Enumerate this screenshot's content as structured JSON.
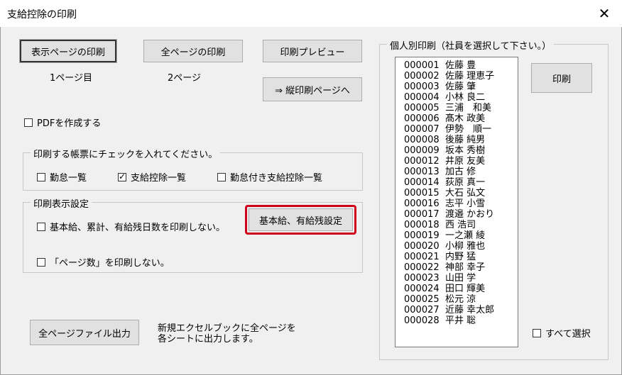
{
  "window": {
    "title": "支給控除の印刷"
  },
  "buttons": {
    "print_display_page": "表示ページの印刷",
    "print_all_pages": "全ページの印刷",
    "print_preview": "印刷プレビュー",
    "vertical_print_page": "⇒ 縦印刷ページへ",
    "print_individual": "印刷",
    "basic_salary_settings": "基本給、有給残設定",
    "all_pages_file_output": "全ページファイル出力"
  },
  "labels": {
    "page_current": "1ページ目",
    "page_total": "2ページ",
    "file_output_desc_1": "新規エクセルブックに全ページを",
    "file_output_desc_2": "各シートに出力します。"
  },
  "checkboxes": {
    "create_pdf": {
      "label": "PDFを作成する",
      "checked": false
    },
    "attendance_list": {
      "label": "勤怠一覧",
      "checked": false
    },
    "payment_deduction_list": {
      "label": "支給控除一覧",
      "checked": true
    },
    "attendance_payment_deduction_list": {
      "label": "勤怠付き支給控除一覧",
      "checked": false
    },
    "no_print_basic_salary": {
      "label": "基本給、累計、有給残日数を印刷しない。",
      "checked": false
    },
    "no_print_page_count": {
      "label": "「ページ数」を印刷しない。",
      "checked": false
    },
    "select_all": {
      "label": "すべて選択",
      "checked": false
    }
  },
  "groups": {
    "report_select": "印刷する帳票にチェックを入れてください。",
    "print_display_settings": "印刷表示設定",
    "individual_print": "個人別印刷（社員を選択して下さい。）"
  },
  "employees": [
    {
      "code": "000001",
      "name": "佐藤 豊"
    },
    {
      "code": "000002",
      "name": "佐藤 理恵子"
    },
    {
      "code": "000003",
      "name": "佐藤 肇"
    },
    {
      "code": "000004",
      "name": "小林 良二"
    },
    {
      "code": "000005",
      "name": "三浦　和美"
    },
    {
      "code": "000006",
      "name": "髙木 政美"
    },
    {
      "code": "000007",
      "name": "伊勢　順一"
    },
    {
      "code": "000008",
      "name": "後藤 純男"
    },
    {
      "code": "000009",
      "name": "坂本 秀樹"
    },
    {
      "code": "000012",
      "name": "井原 友美"
    },
    {
      "code": "000013",
      "name": "加古 修"
    },
    {
      "code": "000014",
      "name": "荻原 真一"
    },
    {
      "code": "000015",
      "name": "大石 弘文"
    },
    {
      "code": "000016",
      "name": "志平 小雪"
    },
    {
      "code": "000017",
      "name": "渡邉 かおり"
    },
    {
      "code": "000018",
      "name": "西 浩司"
    },
    {
      "code": "000019",
      "name": "一之瀬 綾"
    },
    {
      "code": "000020",
      "name": "小柳 雅也"
    },
    {
      "code": "000021",
      "name": "内野 猛"
    },
    {
      "code": "000022",
      "name": "神部 幸子"
    },
    {
      "code": "000023",
      "name": "山田 学"
    },
    {
      "code": "000024",
      "name": "田口 輝美"
    },
    {
      "code": "000025",
      "name": "松元 涼"
    },
    {
      "code": "000027",
      "name": "近藤 幸太郎"
    },
    {
      "code": "000028",
      "name": "平井 聡"
    }
  ],
  "colors": {
    "highlight": "#d0021b"
  }
}
